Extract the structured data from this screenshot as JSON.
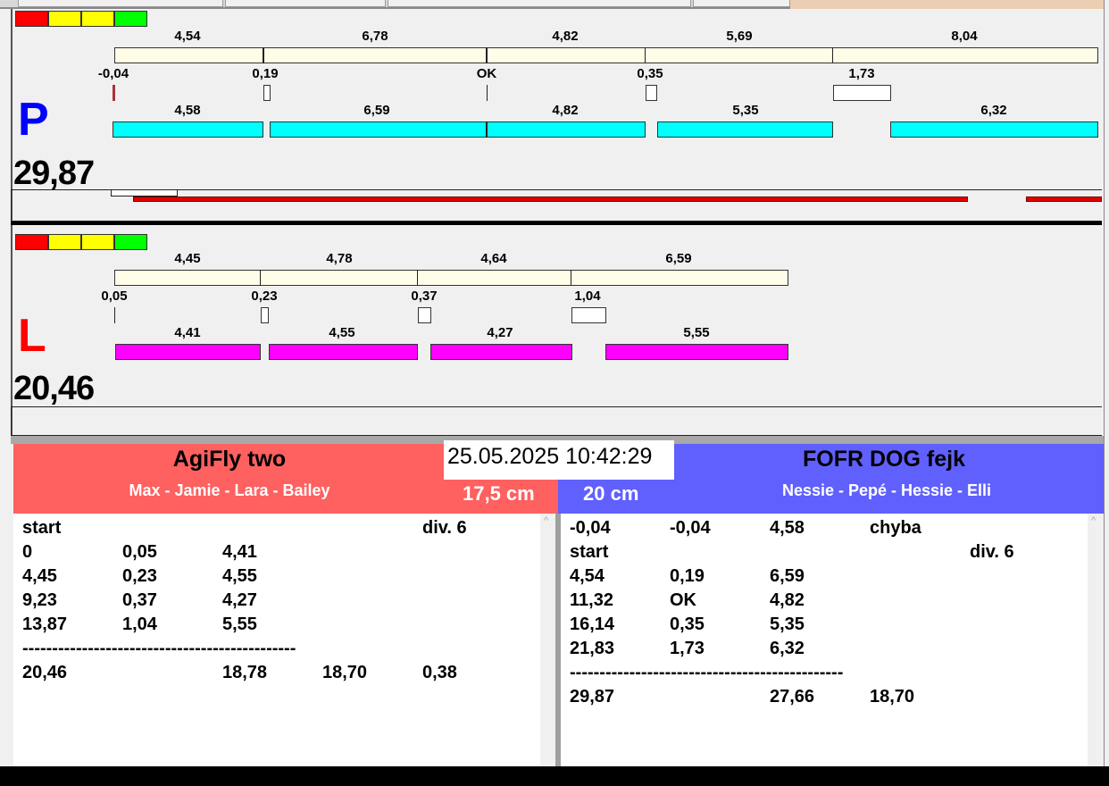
{
  "colors": {
    "red": "#ff0000",
    "yellow": "#ffff00",
    "green": "#00ff00",
    "left_header": "#ff6060",
    "right_header": "#6060ff",
    "cyan": "#00ffff",
    "magenta": "#ff00ff"
  },
  "top": {
    "letter": "P",
    "total": "29,87",
    "split_labels": [
      "4,54",
      "6,78",
      "4,82",
      "5,69",
      "8,04"
    ],
    "gap_labels": [
      "-0,04",
      "0,19",
      "OK",
      "0,35",
      "1,73"
    ],
    "run_labels": [
      "4,58",
      "6,59",
      "4,82",
      "5,35",
      "6,32"
    ]
  },
  "bottom": {
    "letter": "L",
    "total": "20,46",
    "split_labels": [
      "4,45",
      "4,78",
      "4,64",
      "6,59"
    ],
    "gap_labels": [
      "0,05",
      "0,23",
      "0,37",
      "1,04"
    ],
    "run_labels": [
      "4,41",
      "4,55",
      "4,27",
      "5,55"
    ]
  },
  "datetime": "25.05.2025 10:42:29",
  "left_team": {
    "name": "AgiFly two",
    "dogs": "Max - Jamie - Lara - Bailey",
    "height": "17,5 cm",
    "rows": [
      [
        "start",
        "",
        "",
        "",
        "div.  6"
      ],
      [
        "0",
        "0,05",
        "4,41",
        "",
        ""
      ],
      [
        "4,45",
        "0,23",
        "4,55",
        "",
        ""
      ],
      [
        "9,23",
        "0,37",
        "4,27",
        "",
        ""
      ],
      [
        "13,87",
        "1,04",
        "5,55",
        "",
        ""
      ],
      [
        "----------------------------------------------",
        "",
        "",
        "",
        ""
      ],
      [
        "20,46",
        "",
        "18,78",
        "18,70",
        "0,38"
      ]
    ]
  },
  "right_team": {
    "name": "FOFR DOG fejk",
    "dogs": "Nessie - Pepé - Hessie - Elli",
    "height": "20 cm",
    "rows": [
      [
        "-0,04",
        "-0,04",
        "4,58",
        "chyba",
        ""
      ],
      [
        "start",
        "",
        "",
        "",
        "div.  6"
      ],
      [
        "4,54",
        "0,19",
        "6,59",
        "",
        ""
      ],
      [
        "11,32",
        "OK",
        "4,82",
        "",
        ""
      ],
      [
        "16,14",
        "0,35",
        "5,35",
        "",
        ""
      ],
      [
        "21,83",
        "1,73",
        "6,32",
        "",
        ""
      ],
      [
        "----------------------------------------------",
        "",
        "",
        "",
        ""
      ],
      [
        "29,87",
        "",
        "27,66",
        "18,70",
        ""
      ]
    ]
  }
}
